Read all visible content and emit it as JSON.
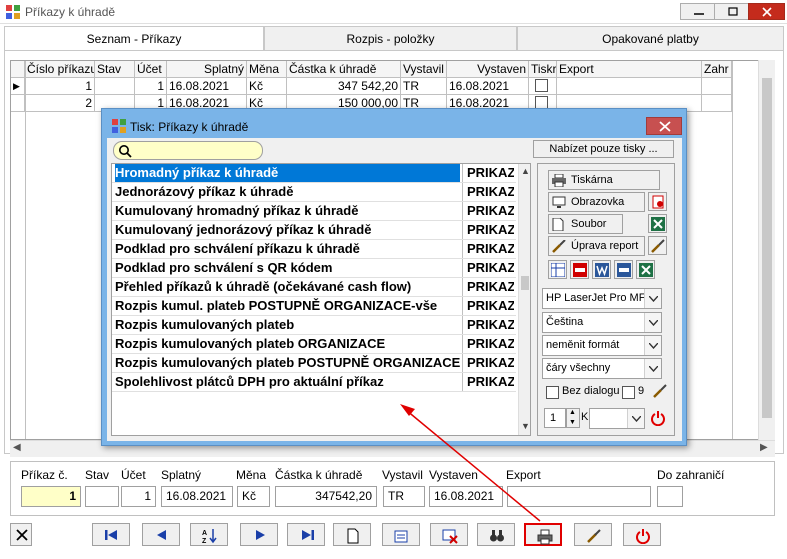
{
  "window": {
    "title": "Příkazy k úhradě"
  },
  "tabs": [
    {
      "label": "Seznam - Příkazy"
    },
    {
      "label": "Rozpis - položky"
    },
    {
      "label": "Opakované platby"
    }
  ],
  "grid": {
    "headers": [
      "Číslo příkazu",
      "Stav",
      "Účet",
      "Splatný",
      "Měna",
      "Částka k úhradě",
      "Vystavil",
      "Vystaven",
      "Tiskr",
      "Export",
      "Zahr"
    ],
    "rows": [
      {
        "cislo": "1",
        "stav": "",
        "ucet": "1",
        "splatny": "16.08.2021",
        "mena": "Kč",
        "castka": "347 542,20",
        "vystavil": "TR",
        "vystaven": "16.08.2021"
      },
      {
        "cislo": "2",
        "stav": "",
        "ucet": "1",
        "splatny": "16.08.2021",
        "mena": "Kč",
        "castka": "150 000,00",
        "vystavil": "TR",
        "vystaven": "16.08.2021"
      }
    ]
  },
  "dialog": {
    "title": "Tisk: Příkazy k úhradě",
    "offer_only_prints": "Nabízet pouze tisky ...",
    "templates": [
      {
        "name": "Hromadný příkaz k úhradě",
        "code": "PRIKAZ"
      },
      {
        "name": "Jednorázový příkaz k úhradě",
        "code": "PRIKAZ"
      },
      {
        "name": "Kumulovaný hromadný příkaz k úhradě",
        "code": "PRIKAZ"
      },
      {
        "name": "Kumulovaný jednorázový příkaz k úhradě",
        "code": "PRIKAZ"
      },
      {
        "name": "Podklad pro schválení příkazu k úhradě",
        "code": "PRIKAZ"
      },
      {
        "name": "Podklad pro schválení s QR kódem",
        "code": "PRIKAZ"
      },
      {
        "name": "Přehled příkazů k úhradě (očekávané cash flow)",
        "code": "PRIKAZ"
      },
      {
        "name": "Rozpis kumul. plateb POSTUPNĚ ORGANIZACE-vše",
        "code": "PRIKAZ"
      },
      {
        "name": "Rozpis kumulovaných plateb",
        "code": "PRIKAZ"
      },
      {
        "name": "Rozpis kumulovaných plateb ORGANIZACE",
        "code": "PRIKAZ"
      },
      {
        "name": "Rozpis kumulovaných plateb POSTUPNĚ ORGANIZACE",
        "code": "PRIKAZ"
      },
      {
        "name": "Spolehlivost plátců DPH pro aktuální příkaz",
        "code": "PRIKAZ"
      }
    ],
    "buttons": {
      "printer": "Tiskárna",
      "screen": "Obrazovka",
      "file": "Soubor",
      "edit_report": "Úprava report"
    },
    "printer_value": "HP LaserJet Pro MFP",
    "language_value": "Čeština",
    "format_value": "neměnit formát",
    "lines_value": "čáry všechny",
    "no_dialog_label": "Bez dialogu",
    "copies_label": "9",
    "count_value": "1",
    "k_label": "K"
  },
  "detail": {
    "labels": {
      "prikaz": "Příkaz č.",
      "stav": "Stav",
      "ucet": "Účet",
      "splatny": "Splatný",
      "mena": "Měna",
      "castka": "Částka k úhradě",
      "vystavil": "Vystavil",
      "vystaven": "Vystaven",
      "export": "Export",
      "zahranici": "Do zahraničí"
    },
    "values": {
      "prikaz": "1",
      "stav": "",
      "ucet": "1",
      "splatny": "16.08.2021",
      "mena": "Kč",
      "castka": "347542,20",
      "vystavil": "TR",
      "vystaven": "16.08.2021",
      "export": ""
    }
  },
  "colors": {
    "accent": "#0078d7",
    "dialog_frame": "#7ab4e8",
    "highlight": "#ffffc8",
    "annotation": "#e00000"
  }
}
